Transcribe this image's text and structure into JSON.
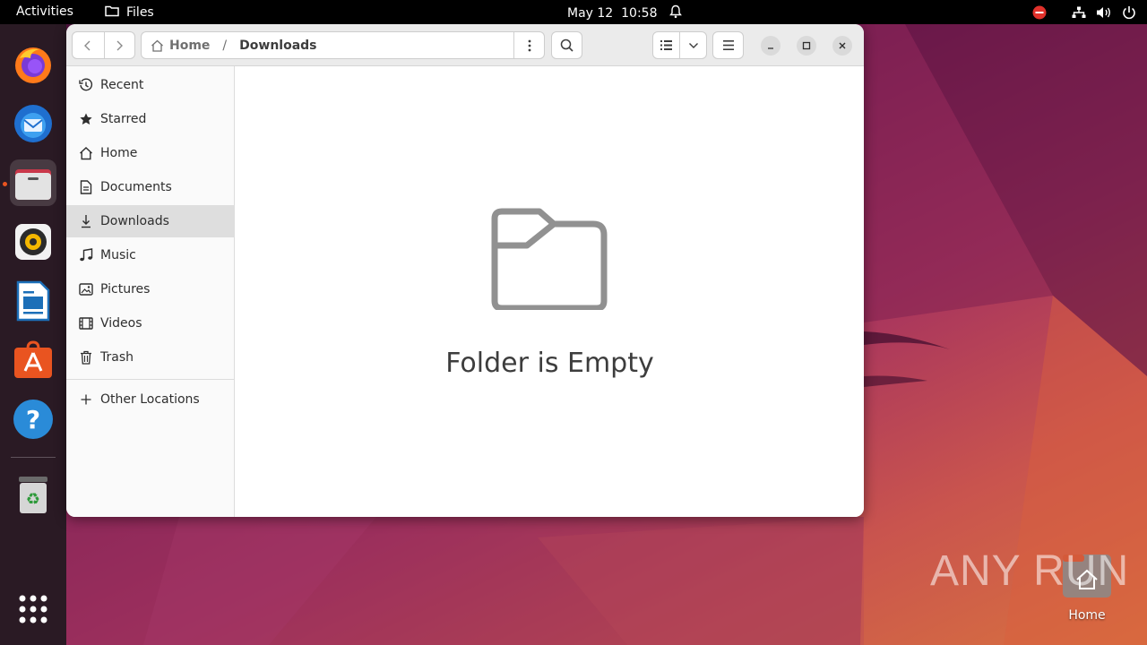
{
  "topbar": {
    "activities": "Activities",
    "app_name": "Files",
    "date": "May 12",
    "time": "10:58",
    "tray_icons": [
      "do-not-disturb-icon",
      "network-icon",
      "volume-icon",
      "power-icon"
    ]
  },
  "dock": {
    "items": [
      {
        "name": "firefox"
      },
      {
        "name": "thunderbird"
      },
      {
        "name": "files"
      },
      {
        "name": "rhythmbox"
      },
      {
        "name": "libreoffice-writer"
      },
      {
        "name": "ubuntu-software"
      },
      {
        "name": "help"
      },
      {
        "name": "trash"
      },
      {
        "name": "show-applications"
      }
    ]
  },
  "window": {
    "path": {
      "home": "Home",
      "separator": "/",
      "current": "Downloads"
    },
    "sidebar": {
      "items": [
        {
          "label": "Recent",
          "icon": "clock-icon"
        },
        {
          "label": "Starred",
          "icon": "star-icon"
        },
        {
          "label": "Home",
          "icon": "home-icon"
        },
        {
          "label": "Documents",
          "icon": "document-icon"
        },
        {
          "label": "Downloads",
          "icon": "download-icon",
          "selected": true
        },
        {
          "label": "Music",
          "icon": "music-icon"
        },
        {
          "label": "Pictures",
          "icon": "picture-icon"
        },
        {
          "label": "Videos",
          "icon": "video-icon"
        },
        {
          "label": "Trash",
          "icon": "trash-icon"
        }
      ],
      "other_locations": "Other Locations"
    },
    "empty_message": "Folder is Empty"
  },
  "desktop": {
    "home_label": "Home",
    "watermark": "ANY RUN"
  },
  "colors": {
    "accent": "#e95420",
    "topbar": "#000000",
    "dock": "#2a1a24"
  }
}
